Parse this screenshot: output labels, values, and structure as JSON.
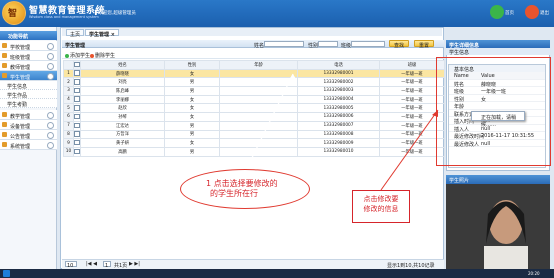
{
  "header": {
    "brand": "智慧教育管理系统",
    "brand_sub": "Wisdom class and management system",
    "welcome": "▌欢迎您,超级管理员",
    "home_label": "首页",
    "exit_label": "退出"
  },
  "sidebar": {
    "title": "功能导航",
    "items": [
      {
        "label": "学校管理"
      },
      {
        "label": "班级管理"
      },
      {
        "label": "教师管理"
      },
      {
        "label": "学生管理"
      },
      {
        "label": "教学管理"
      },
      {
        "label": "设备管理"
      },
      {
        "label": "公告管理"
      },
      {
        "label": "系统管理"
      }
    ],
    "subitems": [
      {
        "label": "学生信息"
      },
      {
        "label": "学生作品"
      },
      {
        "label": "学生考勤"
      }
    ]
  },
  "tabs": {
    "home": "主页",
    "active": "学生管理 ×"
  },
  "grid": {
    "title": "学生管理",
    "filter_name_label": "姓名",
    "filter_gender_label": "性别",
    "filter_class_label": "班级",
    "search_button": "查找",
    "reset_button": "重置",
    "add_label": "添加学生",
    "delete_label": "删除学生",
    "columns": [
      "姓名",
      "性别",
      "年龄",
      "电话",
      "班级"
    ],
    "rows": [
      {
        "n": "1",
        "name": "薛晓晓",
        "gender": "女",
        "age": "",
        "phone": "13332980001",
        "cls": "一年级一班"
      },
      {
        "n": "2",
        "name": "刘亮",
        "gender": "男",
        "age": "",
        "phone": "13332980002",
        "cls": "一年级一班"
      },
      {
        "n": "3",
        "name": "陈启峰",
        "gender": "男",
        "age": "",
        "phone": "13332980003",
        "cls": "一年级一班"
      },
      {
        "n": "4",
        "name": "李丽娜",
        "gender": "女",
        "age": "",
        "phone": "13332980004",
        "cls": "一年级一班"
      },
      {
        "n": "5",
        "name": "赵欣",
        "gender": "女",
        "age": "",
        "phone": "13332980005",
        "cls": "一年级一班"
      },
      {
        "n": "6",
        "name": "孙琴",
        "gender": "女",
        "age": "",
        "phone": "13332980006",
        "cls": "一年级一班"
      },
      {
        "n": "7",
        "name": "江宏达",
        "gender": "男",
        "age": "",
        "phone": "13332980007",
        "cls": "一年级一班"
      },
      {
        "n": "8",
        "name": "方哲洋",
        "gender": "男",
        "age": "",
        "phone": "13332980008",
        "cls": "一年级一班"
      },
      {
        "n": "9",
        "name": "黄子妍",
        "gender": "女",
        "age": "",
        "phone": "13332980009",
        "cls": "一年级一班"
      },
      {
        "n": "10",
        "name": "高鹏",
        "gender": "男",
        "age": "",
        "phone": "13332980010",
        "cls": "一年级一班"
      }
    ],
    "selected_row": 0
  },
  "pager": {
    "page_size": "10",
    "page_input": "1",
    "page_total": "共1页",
    "summary": "显示1到10,共10记录"
  },
  "right_panel": {
    "title": "学生详细信息",
    "subtitle": "学生信息",
    "pg_title": "基本信息",
    "pg_header_key": "Name",
    "pg_header_value": "Value",
    "props": [
      {
        "k": "姓名",
        "v": "薛晓晓"
      },
      {
        "k": "班级",
        "v": "一年级一班"
      },
      {
        "k": "性别",
        "v": "女"
      },
      {
        "k": "年龄",
        "v": ""
      },
      {
        "k": "联系方式",
        "v": ""
      },
      {
        "k": "插入时间",
        "v": "null"
      },
      {
        "k": "插入人",
        "v": "null"
      },
      {
        "k": "最近修改时间",
        "v": "2016-11-17 10:31:55"
      },
      {
        "k": "最近修改人",
        "v": "null"
      }
    ],
    "loading_text": "正在加载，请稍候……",
    "video_title": "学生照片"
  },
  "annotations": {
    "ellipse_line1": "1 点击选择要修改的",
    "ellipse_line2": "的学生所在行",
    "note_line1": "点击修改要",
    "note_line2": "修改的信息"
  },
  "taskbar": {
    "clock": "20:20"
  },
  "colors": {
    "header": "#1b5fae",
    "selected_row": "#fbe6a2",
    "annotation_red": "#d6252b"
  }
}
